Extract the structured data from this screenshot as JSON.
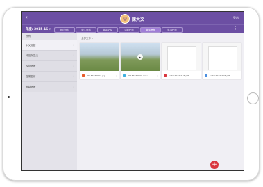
{
  "header": {
    "back_icon": "‹",
    "avatar_glyph": "☺",
    "username": "陳大文",
    "logout": "登出"
  },
  "toolbar": {
    "year": "年度: 2015-16 ▾",
    "more": "⋮",
    "tabs": [
      "帳戶資料",
      "學生資料",
      "學習紀錄",
      "活動紀錄",
      "學習歷程",
      "獎項紀錄"
    ],
    "active_tab": 4
  },
  "sidebar": {
    "header": "所有",
    "items": [
      {
        "label": "中文閱讀",
        "active": true
      },
      {
        "label": "科技與生活",
        "active": false
      },
      {
        "label": "視覺藝術",
        "active": false
      },
      {
        "label": "音樂藝術",
        "active": false
      },
      {
        "label": "戲劇藝術",
        "active": false
      }
    ],
    "arrow": "›"
  },
  "content": {
    "filter": "全部文件 ▾",
    "files": [
      {
        "name": "20161071504.jpg",
        "kind": "image",
        "icon_color": "#e85a2a"
      },
      {
        "name": "20161071509.mov",
        "kind": "video",
        "icon_color": "#3fb0e0"
      },
      {
        "name": "notes20171124.pdf",
        "kind": "pdf",
        "icon_color": "#d9363e"
      },
      {
        "name": "notes20171124.pdf",
        "kind": "pdf",
        "icon_color": "#4a8ee0"
      }
    ],
    "file_menu": "⋮",
    "play_icon": "▶"
  },
  "fab": {
    "label": "+"
  },
  "colors": {
    "primary": "#6c4fa3",
    "active_tab": "#9f7dd6",
    "fab": "#d9363e"
  }
}
